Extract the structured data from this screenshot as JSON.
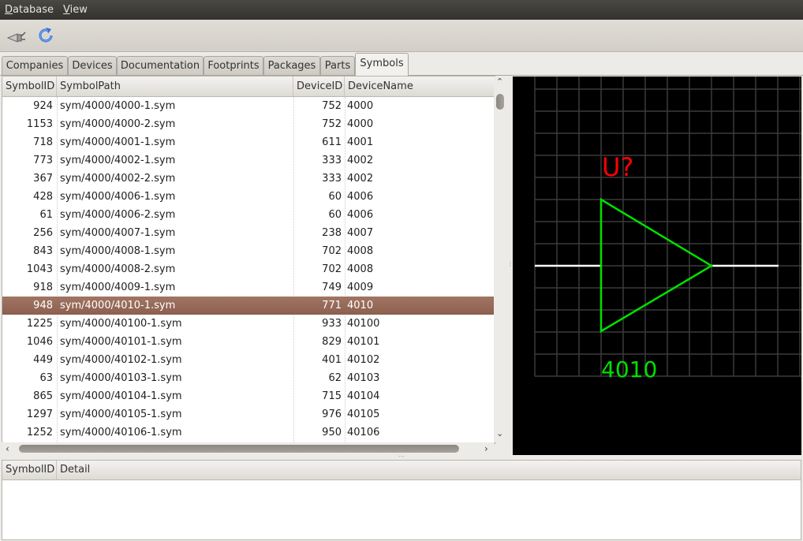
{
  "menu": [
    {
      "label": "Database",
      "accel": "D",
      "rest": "atabase"
    },
    {
      "label": "View",
      "accel": "V",
      "rest": "iew"
    }
  ],
  "toolbar": {
    "buttons": [
      {
        "icon": "connect-plug-icon"
      },
      {
        "icon": "refresh-icon"
      }
    ]
  },
  "tabs": [
    "Companies",
    "Devices",
    "Documentation",
    "Footprints",
    "Packages",
    "Parts",
    "Symbols"
  ],
  "active_tab": "Symbols",
  "table": {
    "columns": [
      "SymbolID",
      "SymbolPath",
      "DeviceID",
      "DeviceName"
    ],
    "rows": [
      [
        "924",
        "sym/4000/4000-1.sym",
        "752",
        "4000"
      ],
      [
        "1153",
        "sym/4000/4000-2.sym",
        "752",
        "4000"
      ],
      [
        "718",
        "sym/4000/4001-1.sym",
        "611",
        "4001"
      ],
      [
        "773",
        "sym/4000/4002-1.sym",
        "333",
        "4002"
      ],
      [
        "367",
        "sym/4000/4002-2.sym",
        "333",
        "4002"
      ],
      [
        "428",
        "sym/4000/4006-1.sym",
        "60",
        "4006"
      ],
      [
        "61",
        "sym/4000/4006-2.sym",
        "60",
        "4006"
      ],
      [
        "256",
        "sym/4000/4007-1.sym",
        "238",
        "4007"
      ],
      [
        "843",
        "sym/4000/4008-1.sym",
        "702",
        "4008"
      ],
      [
        "1043",
        "sym/4000/4008-2.sym",
        "702",
        "4008"
      ],
      [
        "918",
        "sym/4000/4009-1.sym",
        "749",
        "4009"
      ],
      [
        "948",
        "sym/4000/4010-1.sym",
        "771",
        "4010"
      ],
      [
        "1225",
        "sym/4000/40100-1.sym",
        "933",
        "40100"
      ],
      [
        "1046",
        "sym/4000/40101-1.sym",
        "829",
        "40101"
      ],
      [
        "449",
        "sym/4000/40102-1.sym",
        "401",
        "40102"
      ],
      [
        "63",
        "sym/4000/40103-1.sym",
        "62",
        "40103"
      ],
      [
        "865",
        "sym/4000/40104-1.sym",
        "715",
        "40104"
      ],
      [
        "1297",
        "sym/4000/40105-1.sym",
        "976",
        "40105"
      ],
      [
        "1252",
        "sym/4000/40106-1.sym",
        "950",
        "40106"
      ]
    ],
    "selected_row": 11
  },
  "preview": {
    "refdes": "U?",
    "device_label": "4010",
    "colors": {
      "background": "#000000",
      "grid": "#3a3a3a",
      "symbol": "#00e000",
      "refdes": "#ff0000",
      "pins": "#ffffff"
    }
  },
  "detail": {
    "columns": [
      "SymbolID",
      "Detail"
    ]
  }
}
